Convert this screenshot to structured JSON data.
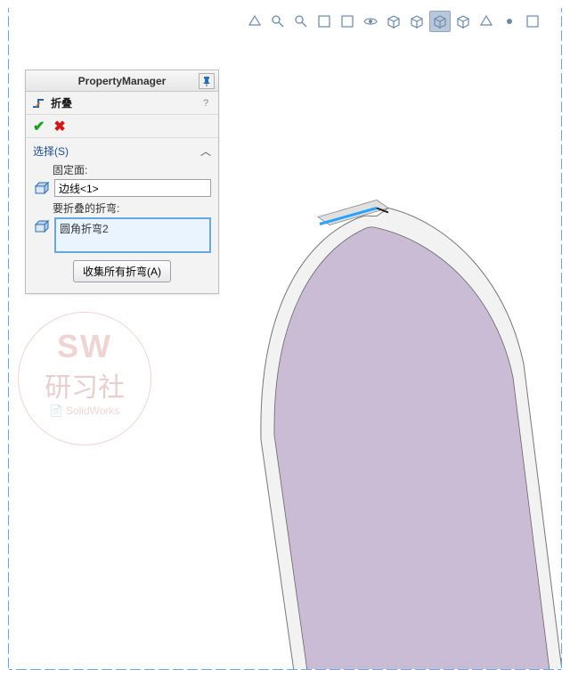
{
  "panel": {
    "title": "PropertyManager",
    "feature_name": "折叠",
    "section_header": "选择(S)",
    "fixed_face_label": "固定面:",
    "fixed_face_value": "边线<1>",
    "bends_label": "要折叠的折弯:",
    "bends_value": "圆角折弯2",
    "collect_button": "收集所有折弯(A)"
  },
  "watermark": {
    "line1": "SW",
    "line2": "研习社",
    "line3": "SolidWorks"
  },
  "toolbar_icons": [
    "dropdown-icon",
    "zoom-fit-icon",
    "zoom-area-icon",
    "section-icon",
    "display-style-icon",
    "perspective-icon",
    "scene-icon",
    "appearance-icon",
    "view-orientation-icon",
    "hide-show-icon",
    "more-icon",
    "focus-icon",
    "save-view-icon"
  ],
  "toolbar_active_index": 8
}
